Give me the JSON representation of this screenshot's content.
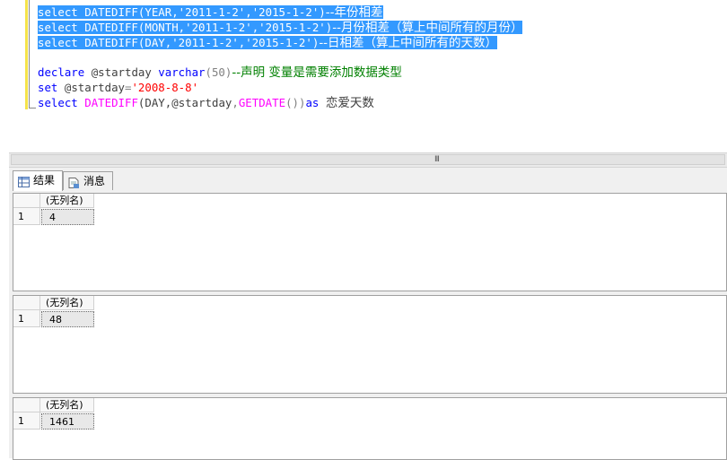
{
  "editor": {
    "lines": [
      {
        "code": "select DATEDIFF(YEAR,'2011-1-2','2015-1-2')",
        "comment": "--年份相差"
      },
      {
        "code": "select DATEDIFF(MONTH,'2011-1-2','2015-1-2')",
        "comment": "--月份相差（算上中间所有的月份）"
      },
      {
        "code": "select DATEDIFF(DAY,'2011-1-2','2015-1-2')",
        "comment": "--日相差（算上中间所有的天数）"
      }
    ],
    "declare_kw": "declare",
    "declare_var": "@startday",
    "declare_type": "varchar",
    "declare_size": "(50)",
    "declare_comment": "--声明 变量是需要添加数据类型",
    "set_kw": "set",
    "set_var": "@startday",
    "set_eq": "=",
    "set_value": "'2008-8-8'",
    "select_kw": "select",
    "select_fn": "DATEDIFF",
    "select_args_a": "(DAY,",
    "select_var": "@startday",
    "select_comma": ",",
    "select_fn2": "GETDATE",
    "select_parens": "())",
    "select_as": "as",
    "select_alias": "恋爱天数"
  },
  "scrollbar": {
    "grip": "III"
  },
  "tabs": [
    {
      "label": "结果",
      "icon": "grid-icon",
      "active": true
    },
    {
      "label": "消息",
      "icon": "message-doc-icon",
      "active": false
    }
  ],
  "results": [
    {
      "column": "(无列名)",
      "row": "1",
      "value": "4"
    },
    {
      "column": "(无列名)",
      "row": "1",
      "value": "48"
    },
    {
      "column": "(无列名)",
      "row": "1",
      "value": "1461"
    }
  ],
  "colors": {
    "selection": "#3399ff",
    "keyword": "#0000ff",
    "function": "#ff00ff",
    "string": "#ff0000",
    "comment": "#008000"
  }
}
